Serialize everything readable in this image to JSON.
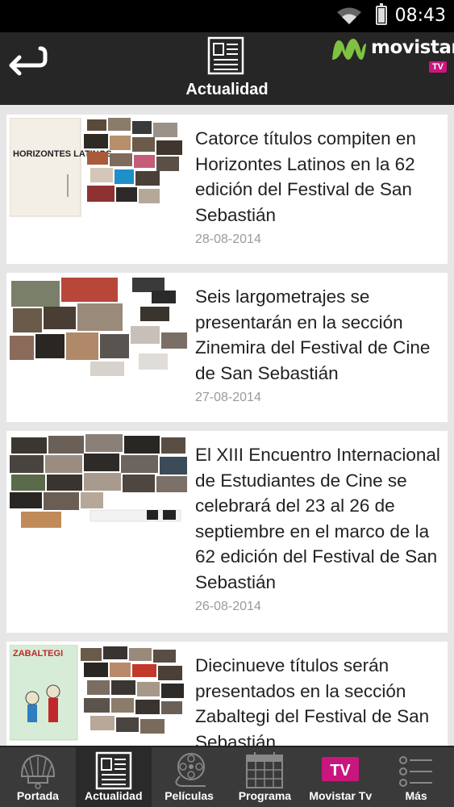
{
  "status_bar": {
    "time": "08:43"
  },
  "header": {
    "section_title": "Actualidad",
    "brand_name": "movistar",
    "brand_badge": "TV"
  },
  "articles": [
    {
      "title": "Catorce títulos compiten en Horizontes Latinos en la 62 edición del Festival de San Sebastián",
      "date": "28-08-2014",
      "poster_text": "HORIZONTES LATINOS"
    },
    {
      "title": "Seis largometrajes se presentarán en la sección Zinemira del Festival de Cine de San Sebastián",
      "date": "27-08-2014"
    },
    {
      "title": "El XIII Encuentro Internacional de Estudiantes de Cine se celebrará del 23 al 26 de septiembre en el marco de la 62 edición del Festival de San Sebastián",
      "date": "26-08-2014"
    },
    {
      "title": "Diecinueve títulos serán presentados en la sección Zabaltegi del Festival de San Sebastián",
      "date": "",
      "poster_text": "ZABALTEGI"
    }
  ],
  "bottom_nav": [
    {
      "label": "Portada",
      "icon": "shell-icon"
    },
    {
      "label": "Actualidad",
      "icon": "newspaper-icon",
      "active": true
    },
    {
      "label": "Películas",
      "icon": "film-reel-icon"
    },
    {
      "label": "Programa",
      "icon": "calendar-icon"
    },
    {
      "label": "Movistar Tv",
      "icon": "tv-icon",
      "badge": "TV"
    },
    {
      "label": "Más",
      "icon": "more-list-icon"
    }
  ],
  "colors": {
    "brand_green": "#7fc242",
    "brand_magenta": "#c9167e",
    "header_bg": "#262626",
    "nav_bg": "#3a3a3a"
  }
}
